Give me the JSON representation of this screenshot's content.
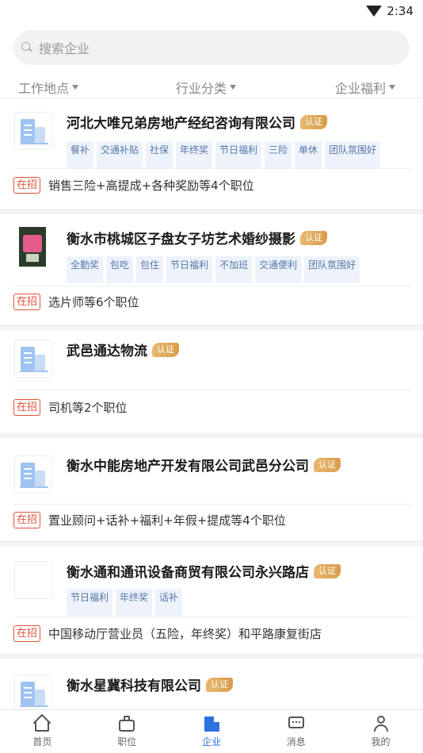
{
  "status_bar": {
    "time": "2:34"
  },
  "search": {
    "placeholder": "搜索企业"
  },
  "filters": [
    "工作地点",
    "行业分类",
    "企业福利"
  ],
  "companies": [
    {
      "name": "河北大唯兄弟房地产经纪咨询有限公司",
      "badge": "认证",
      "logo": "building-icon",
      "tags": [
        "餐补",
        "交通补贴",
        "社保",
        "年终奖",
        "节日福利",
        "三险",
        "单休",
        "团队氛围好"
      ],
      "status": "在招",
      "jobs": "销售三险+高提成+各种奖励等4个职位"
    },
    {
      "name": "衡水市桃城区子盘女子坊艺术婚纱摄影",
      "badge": "认证",
      "logo": "storefront-photo",
      "tags": [
        "全勤奖",
        "包吃",
        "包住",
        "节日福利",
        "不加班",
        "交通便利",
        "团队氛围好"
      ],
      "status": "在招",
      "jobs": "选片师等6个职位"
    },
    {
      "name": "武邑通达物流",
      "badge": "认证",
      "logo": "building-icon",
      "tags": [],
      "status": "在招",
      "jobs": "司机等2个职位"
    },
    {
      "name": "衡水中能房地产开发有限公司武邑分公司",
      "badge": "认证",
      "logo": "building-icon",
      "tags": [],
      "status": "在招",
      "jobs": "置业顾问+话补+福利+年假+提成等4个职位"
    },
    {
      "name": "衡水通和通讯设备商贸有限公司永兴路店",
      "badge": "认证",
      "logo": "blank-logo",
      "tags": [
        "节日福利",
        "年终奖",
        "话补"
      ],
      "status": "在招",
      "jobs": "中国移动厅营业员（五险，年终奖）和平路康复街店"
    },
    {
      "name": "衡水星冀科技有限公司",
      "badge": "认证",
      "logo": "building-icon",
      "tags": [],
      "status": "",
      "jobs": ""
    }
  ],
  "tabbar": {
    "active": "企业",
    "items": [
      {
        "label": "首页",
        "icon": "home-icon"
      },
      {
        "label": "职位",
        "icon": "briefcase-icon"
      },
      {
        "label": "企业",
        "icon": "company-icon"
      },
      {
        "label": "消息",
        "icon": "message-icon"
      },
      {
        "label": "我的",
        "icon": "profile-icon"
      }
    ]
  },
  "colors": {
    "accent": "#2f6fe0",
    "hiring": "#e0523b",
    "badge": "#d89c4c",
    "tag_text": "#5578a8",
    "tag_bg": "#eef3fb"
  }
}
